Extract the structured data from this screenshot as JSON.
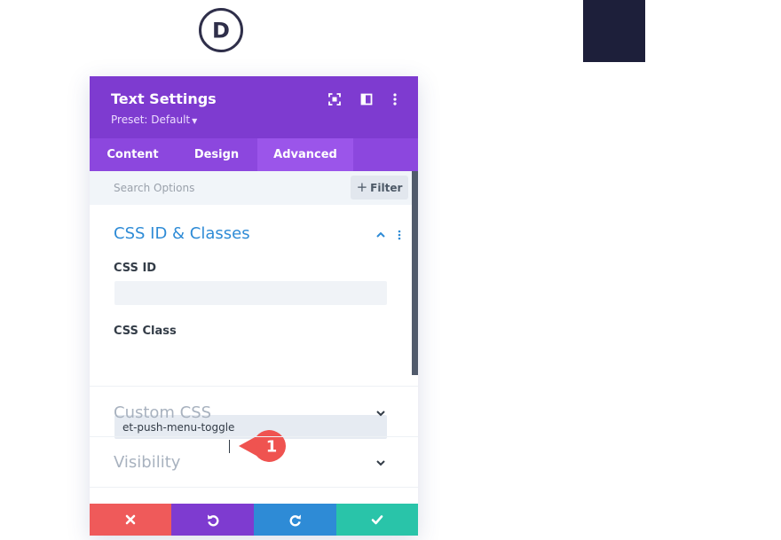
{
  "logo": {
    "letter": "D",
    "icon": "divi-logo-icon",
    "color": "#2f2f4a"
  },
  "background_block": {
    "color": "#1d1f3a"
  },
  "settings_panel": {
    "title": "Text Settings",
    "preset_label": "Preset: Default",
    "header_icons": [
      "fullscreen-icon",
      "sidebar-layout-icon",
      "more-options-icon"
    ],
    "colors": {
      "header": "#7e3bd0",
      "tabs": "#8c47de",
      "active_tab": "#9b55ea",
      "accent": "#2e8bd6"
    },
    "tabs": [
      {
        "label": "Content",
        "active": false
      },
      {
        "label": "Design",
        "active": false
      },
      {
        "label": "Advanced",
        "active": true
      }
    ],
    "search": {
      "placeholder": "Search Options",
      "value": ""
    },
    "filter_button": {
      "label": "Filter",
      "icon": "plus-icon"
    },
    "sections": {
      "css_id_classes": {
        "title": "CSS ID & Classes",
        "expanded": true,
        "fields": {
          "css_id": {
            "label": "CSS ID",
            "value": ""
          },
          "css_class": {
            "label": "CSS Class",
            "value": "et-push-menu-toggle"
          }
        }
      },
      "custom_css": {
        "title": "Custom CSS",
        "expanded": false
      },
      "visibility": {
        "title": "Visibility",
        "expanded": false
      }
    },
    "step_marker": {
      "number": "1",
      "color": "#ef5350"
    },
    "footer_buttons": [
      {
        "action": "cancel",
        "icon": "close-icon",
        "color": "#ef5a5a"
      },
      {
        "action": "undo",
        "icon": "undo-icon",
        "color": "#7e3bd0"
      },
      {
        "action": "redo",
        "icon": "redo-icon",
        "color": "#2e8bd6"
      },
      {
        "action": "save",
        "icon": "check-icon",
        "color": "#29c4a9"
      }
    ]
  }
}
